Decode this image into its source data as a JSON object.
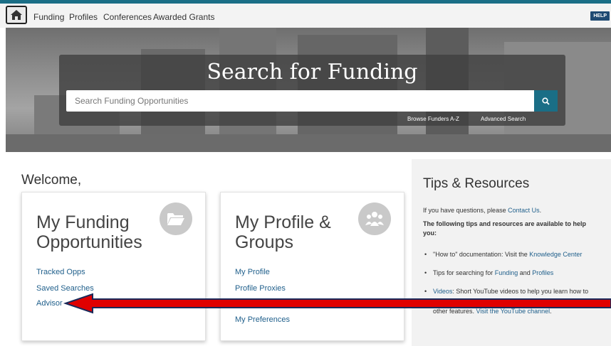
{
  "nav": {
    "home_icon": "home-icon",
    "links": [
      "Funding",
      "Profiles",
      "Conferences",
      "Awarded Grants"
    ],
    "help_label": "HELP"
  },
  "hero": {
    "title": "Search for Funding",
    "search_placeholder": "Search Funding Opportunities",
    "search_icon": "search-icon",
    "browse_label": "Browse Funders A-Z",
    "advanced_label": "Advanced Search"
  },
  "welcome": "Welcome,",
  "cards": [
    {
      "title": "My Funding Opportunities",
      "icon": "folder-open-icon",
      "links": [
        "Tracked Opps",
        "Saved Searches",
        "Advisor"
      ]
    },
    {
      "title": "My Profile & Groups",
      "icon": "group-icon",
      "links": [
        "My Profile",
        "Profile Proxies",
        "My Preferences"
      ]
    }
  ],
  "tips": {
    "title": "Tips & Resources",
    "intro_prefix": "If you have questions, please ",
    "intro_link": "Contact Us",
    "intro_suffix": ".",
    "lead": "The following tips and resources are available to help you:",
    "bullet1_prefix": "\"How to\" documentation: Visit the ",
    "bullet1_link": "Knowledge Center",
    "bullet2_prefix": "Tips for searching for ",
    "bullet2_link1": "Funding",
    "bullet2_mid": " and ",
    "bullet2_link2": "Profiles",
    "bullet3_link": "Videos",
    "bullet3_text": ": Short YouTube videos to help you learn how to",
    "bullet3_cont": "other features. ",
    "bullet3_link2": "Visit the YouTube channel",
    "bullet3_end": "."
  },
  "colors": {
    "accent": "#1a6e86",
    "link": "#1f5f8b",
    "arrow_red": "#e00000",
    "arrow_outline": "#1a2a5a"
  }
}
